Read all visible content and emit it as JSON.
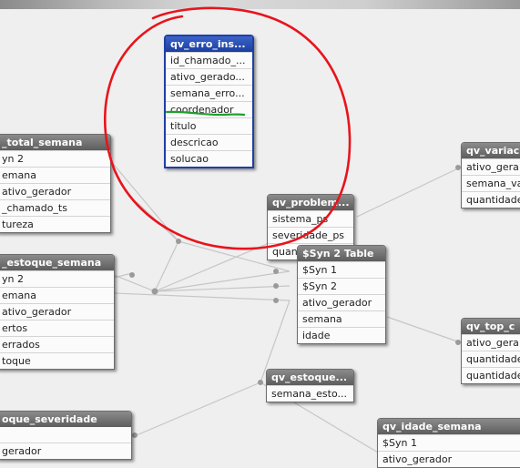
{
  "tables": [
    {
      "id": "erro",
      "title": "qv_erro_ins...",
      "selected": true,
      "fields": [
        "id_chamado_...",
        "ativo_gerado...",
        "semana_erro...",
        "coordenador",
        "titulo",
        "descricao",
        "solucao"
      ]
    },
    {
      "id": "total",
      "title": "_total_semana",
      "fields": [
        "yn 2",
        "emana",
        "ativo_gerador",
        "_chamado_ts",
        "tureza"
      ]
    },
    {
      "id": "estoque",
      "title": "_estoque_semana",
      "fields": [
        "yn 2",
        "emana",
        "ativo_gerador",
        "ertos",
        "errados",
        "toque"
      ]
    },
    {
      "id": "severidade",
      "title": "oque_severidade",
      "fields": [
        "gerador"
      ]
    },
    {
      "id": "problem",
      "title": "qv_problem...",
      "fields": [
        "sistema_ps",
        "severidade_ps",
        "quan"
      ]
    },
    {
      "id": "syn",
      "title": "$Syn 2 Table",
      "fields": [
        "$Syn 1",
        "$Syn 2",
        "ativo_gerador",
        "semana",
        "idade"
      ]
    },
    {
      "id": "estoque2",
      "title": "qv_estoque...",
      "fields": [
        "semana_esto..."
      ]
    },
    {
      "id": "variac",
      "title": "qv_variac",
      "fields": [
        "ativo_gera",
        "semana_va",
        "quantidade"
      ]
    },
    {
      "id": "topc",
      "title": "qv_top_c",
      "fields": [
        "ativo_gera",
        "quantidade",
        "quantidade"
      ]
    },
    {
      "id": "idade",
      "title": "qv_idade_semana",
      "fields": [
        "$Syn 1",
        "ativo_gerador"
      ]
    }
  ],
  "annotation": {
    "circle_color": "#e8141c",
    "underline_color": "#1fa02b",
    "underlined_field": "coordenador"
  },
  "colors": {
    "link": "#c4c4c4",
    "node": "#9a9a9a",
    "selected_header": "#2b4fb8"
  }
}
